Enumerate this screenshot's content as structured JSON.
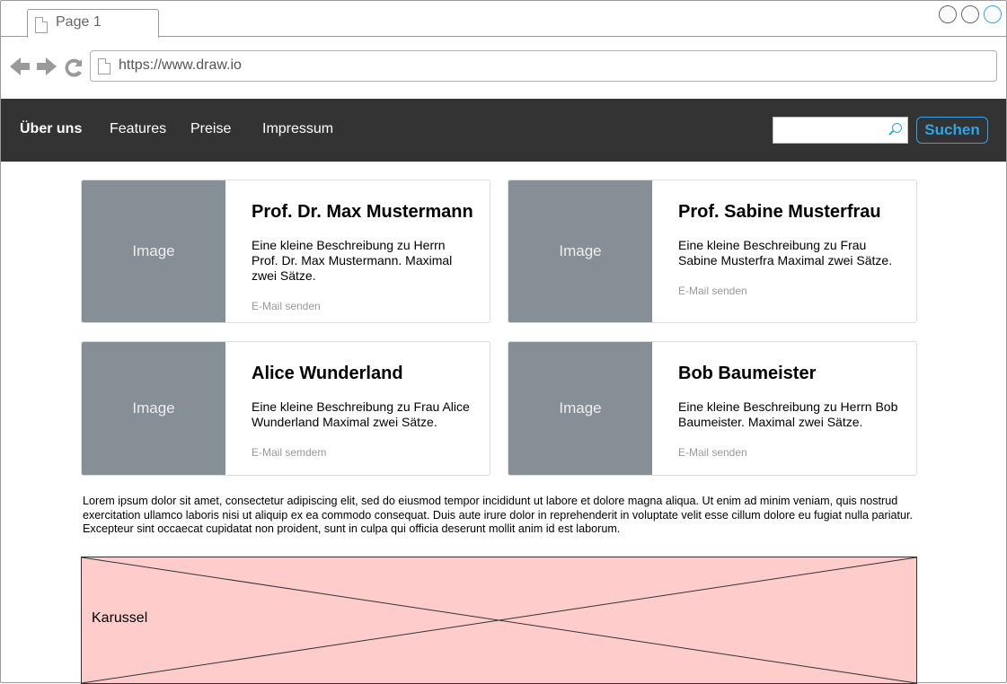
{
  "browser": {
    "tab_label": "Page 1",
    "url": "https://www.draw.io",
    "window_buttons": [
      "circle-button",
      "circle-button",
      "circle-button-active"
    ],
    "back_icon": "back-arrow-icon",
    "forward_icon": "forward-arrow-icon",
    "reload_icon": "reload-icon"
  },
  "nav": {
    "items": [
      "Über uns",
      "Features",
      "Preise",
      "Impressum"
    ],
    "search_placeholder": "",
    "search_button": "Suchen",
    "accent_color": "#2fa4e7",
    "background_color": "#333333"
  },
  "cards": [
    {
      "image": "Image",
      "title": "Prof. Dr. Max Mustermann",
      "desc": "Eine kleine Beschreibung zu Herrn Prof. Dr. Max Mustermann. Maximal zwei Sätze.",
      "mail": "E-Mail senden"
    },
    {
      "image": "Image",
      "title": "Prof. Sabine Musterfrau",
      "desc": "Eine kleine Beschreibung zu Frau Sabine Musterfra Maximal zwei Sätze.",
      "mail": "E-Mail senden"
    },
    {
      "image": "Image",
      "title": "Alice Wunderland",
      "desc": "Eine kleine Beschreibung zu Frau Alice Wunderland Maximal zwei Sätze.",
      "mail": "E-Mail semdem"
    },
    {
      "image": "Image",
      "title": "Bob Baumeister",
      "desc": "Eine kleine Beschreibung zu Herrn Bob Baumeister. Maximal zwei Sätze.",
      "mail": "E-Mail senden"
    }
  ],
  "lorem": "Lorem ipsum dolor sit amet, consectetur adipiscing elit, sed do eiusmod tempor incididunt ut labore et dolore magna aliqua. Ut enim ad minim veniam, quis nostrud exercitation ullamco laboris nisi ut aliquip ex ea commodo consequat. Duis aute irure dolor in reprehenderit in voluptate velit esse cillum dolore eu fugiat nulla pariatur. Excepteur sint occaecat cupidatat non proident, sunt in culpa qui officia deserunt mollit anim id est laborum.",
  "carousel": {
    "label": "Karussel",
    "fill_color": "#ffcccc"
  }
}
